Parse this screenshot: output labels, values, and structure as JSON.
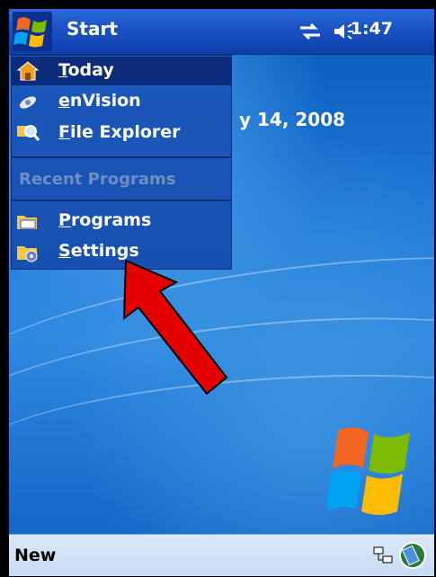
{
  "titlebar": {
    "title": "Start",
    "time": "1:47",
    "status_icons": [
      "connectivity-icon",
      "volume-icon"
    ]
  },
  "start_menu": {
    "items": [
      {
        "label": "Today",
        "icon": "today-icon"
      },
      {
        "label": "enVision",
        "icon": "envision-icon"
      },
      {
        "label": "File Explorer",
        "icon": "file-explorer-icon"
      }
    ],
    "section_label": "Recent Programs",
    "bottom_items": [
      {
        "label": "Programs",
        "icon": "programs-folder-icon"
      },
      {
        "label": "Settings",
        "icon": "settings-folder-icon"
      }
    ]
  },
  "desktop": {
    "date_fragment": "y 14, 2008"
  },
  "taskbar": {
    "left_softkey": "New",
    "icons": [
      "network-icon",
      "sync-icon"
    ]
  },
  "colors": {
    "titlebar": "#1a52c4",
    "menu": "#1a56b8",
    "selected": "#0a2a7a",
    "taskbar": "#d0e3f6",
    "arrow": "#e30000"
  }
}
